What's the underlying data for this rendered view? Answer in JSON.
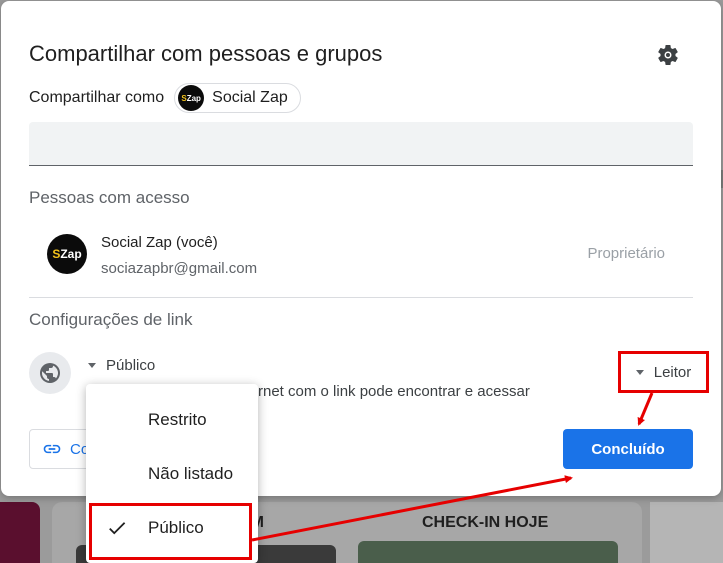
{
  "dialog": {
    "title": "Compartilhar com pessoas e grupos",
    "share_as_label": "Compartilhar como",
    "account_chip_name": "Social Zap",
    "avatar_text_s": "S",
    "avatar_text_zap": "Zap",
    "add_people_placeholder": ""
  },
  "people_section": {
    "heading": "Pessoas com acesso",
    "people": [
      {
        "name": "Social Zap (você)",
        "email": "sociazapbr@gmail.com",
        "role": "Proprietário"
      }
    ]
  },
  "link_section": {
    "heading": "Configurações de link",
    "access_value": "Público",
    "access_description": "rnet com o link pode encontrar e acessar",
    "role_value": "Leitor"
  },
  "footer": {
    "copy_link_label": "Co",
    "done_label": "Concluído"
  },
  "access_menu": {
    "items": [
      {
        "label": "Restrito",
        "selected": false
      },
      {
        "label": "Não listado",
        "selected": false
      },
      {
        "label": "Público",
        "selected": true
      }
    ]
  },
  "background": {
    "card_heading_left": "EM",
    "card_heading_right": "CHECK-IN HOJE"
  },
  "colors": {
    "primary": "#1a73e8",
    "annotation_red": "#e60000"
  },
  "icons": [
    "gear-icon",
    "globe-icon",
    "link-icon",
    "check-icon",
    "caret-down-icon"
  ]
}
